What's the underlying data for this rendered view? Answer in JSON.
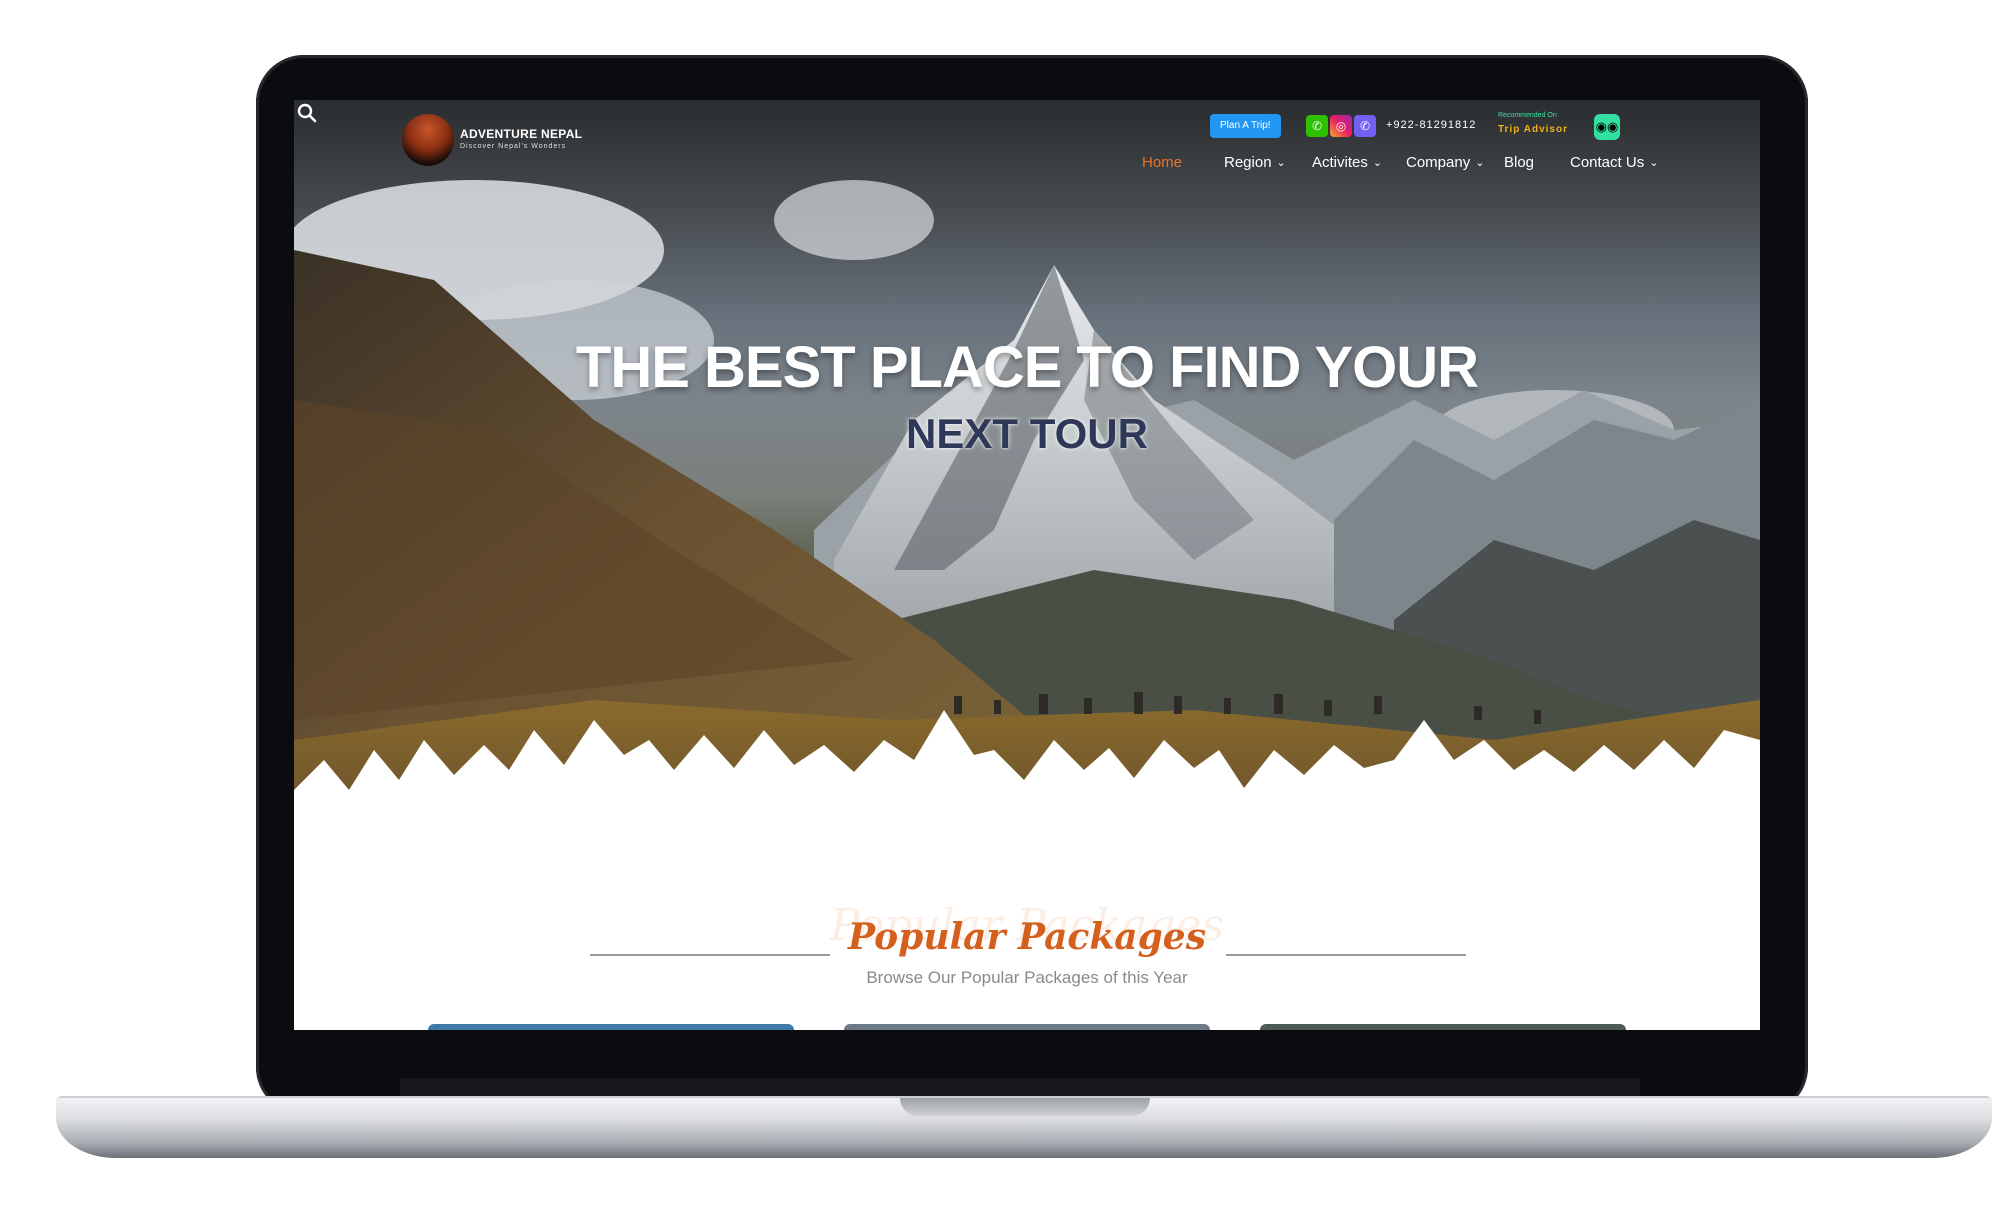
{
  "brand": {
    "name": "ADVENTURE NEPAL",
    "tagline": "Discover Nepal's Wonders"
  },
  "topbar": {
    "plan_trip_label": "Plan A Trip!",
    "phone": "+922-81291812",
    "tripadvisor_recommended": "Recommended On",
    "tripadvisor_name": "Trip Advisor",
    "social_icons": [
      "wechat-icon",
      "instagram-icon",
      "viber-icon"
    ]
  },
  "nav": {
    "items": [
      {
        "label": "Home",
        "active": true
      },
      {
        "label": "Region",
        "dropdown": true
      },
      {
        "label": "Activites",
        "dropdown": true
      },
      {
        "label": "Company",
        "dropdown": true
      },
      {
        "label": "Blog"
      },
      {
        "label": "Contact Us",
        "dropdown": true
      }
    ]
  },
  "hero": {
    "title": "THE BEST PLACE TO FIND YOUR",
    "subtitle": "NEXT TOUR"
  },
  "section": {
    "title": "Popular Packages",
    "subtitle": "Browse Our Popular Packages of this Year"
  },
  "colors": {
    "accent": "#e8742c",
    "section_title": "#d4601d",
    "plan_button": "#2196f3",
    "hero_sub": "#2f3858",
    "tripadvisor": "#34e0a1"
  }
}
